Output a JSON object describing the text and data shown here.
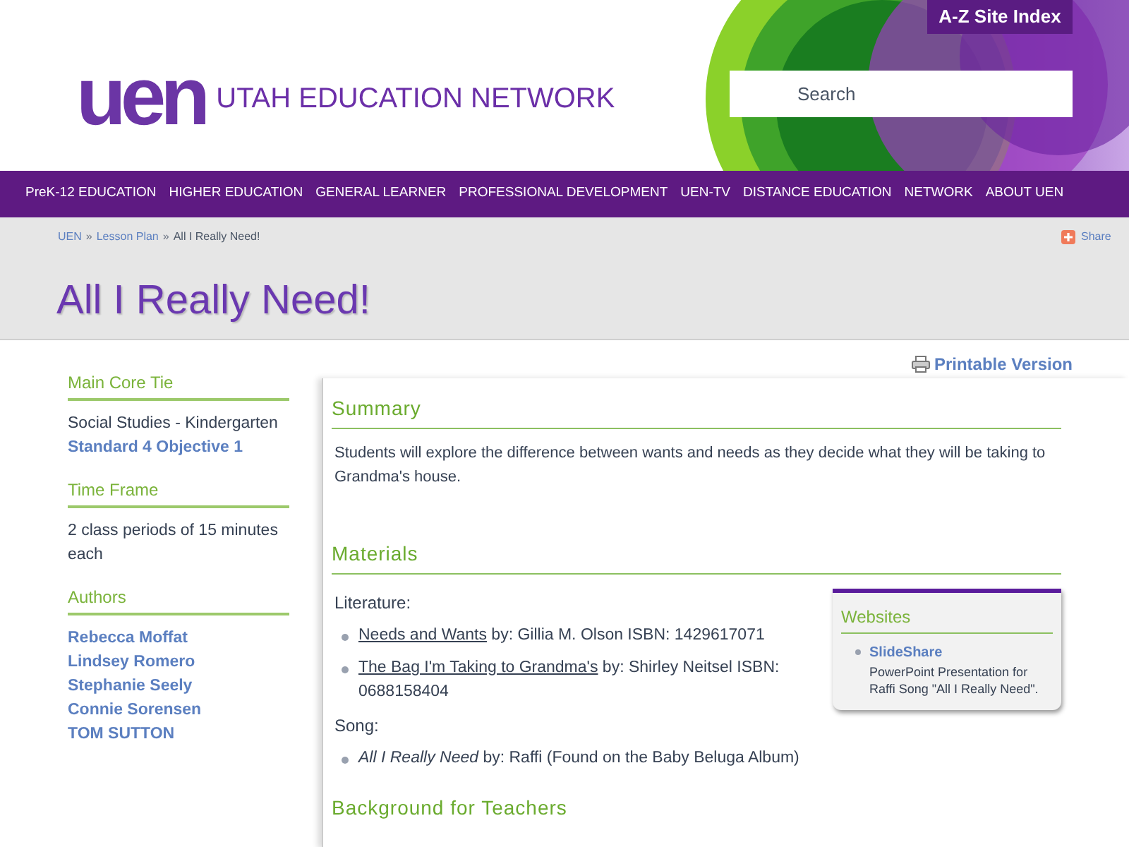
{
  "header": {
    "logo_mark": "uen",
    "logo_text": "UTAH EDUCATION NETWORK",
    "site_index_button": "A-Z Site Index",
    "search": {
      "placeholder": "Search"
    }
  },
  "nav": [
    "PreK-12 EDUCATION",
    "HIGHER EDUCATION",
    "GENERAL LEARNER",
    "PROFESSIONAL DEVELOPMENT",
    "UEN-TV",
    "DISTANCE EDUCATION",
    "NETWORK",
    "ABOUT UEN"
  ],
  "breadcrumb": [
    {
      "label": "UEN",
      "link": true
    },
    {
      "label": "Lesson Plan",
      "link": true
    },
    {
      "label": "All I Really Need!",
      "link": false
    }
  ],
  "breadcrumb_separator": "»",
  "share": "Share",
  "page_title": "All I Really Need!",
  "sidebar": [
    {
      "heading": "Main Core Tie",
      "lines": [
        {
          "text": "Social Studies - Kindergarten",
          "link": false
        },
        {
          "text": "Standard 4 Objective 1",
          "link": true
        }
      ]
    },
    {
      "heading": "Time Frame",
      "lines": [
        {
          "text": "2 class periods of 15 minutes each",
          "link": false
        }
      ]
    },
    {
      "heading": "Authors",
      "lines": [
        {
          "text": "Rebecca Moffat",
          "link": true
        },
        {
          "text": "Lindsey Romero",
          "link": true
        },
        {
          "text": "Stephanie Seely",
          "link": true
        },
        {
          "text": "Connie Sorensen",
          "link": true
        },
        {
          "text": "TOM SUTTON",
          "link": true
        }
      ]
    }
  ],
  "printable_link": "Printable Version",
  "summary": {
    "heading": "Summary",
    "text": "Students will explore the difference between wants and needs as they decide what they will be taking to Grandma's house."
  },
  "materials": {
    "heading": "Materials",
    "groups": [
      {
        "label": "Literature:",
        "items": [
          {
            "kind": "link",
            "title": "Needs and Wants",
            "rest": "by: Gillia M. Olson ISBN: 1429617071"
          },
          {
            "kind": "link",
            "title": "The Bag I'm Taking to Grandma's",
            "rest": "by: Shirley Neitsel ISBN: 0688158404"
          }
        ]
      },
      {
        "label": "Song:",
        "items": [
          {
            "kind": "italic",
            "title": "All I Really Need",
            "rest": "by: Raffi (Found on the Baby Beluga Album)"
          }
        ]
      }
    ]
  },
  "websites": {
    "heading": "Websites",
    "items": [
      {
        "title": "SlideShare",
        "description": "PowerPoint Presentation for Raffi Song \"All I Really Need\"."
      }
    ]
  },
  "next_heading": "Background for Teachers"
}
